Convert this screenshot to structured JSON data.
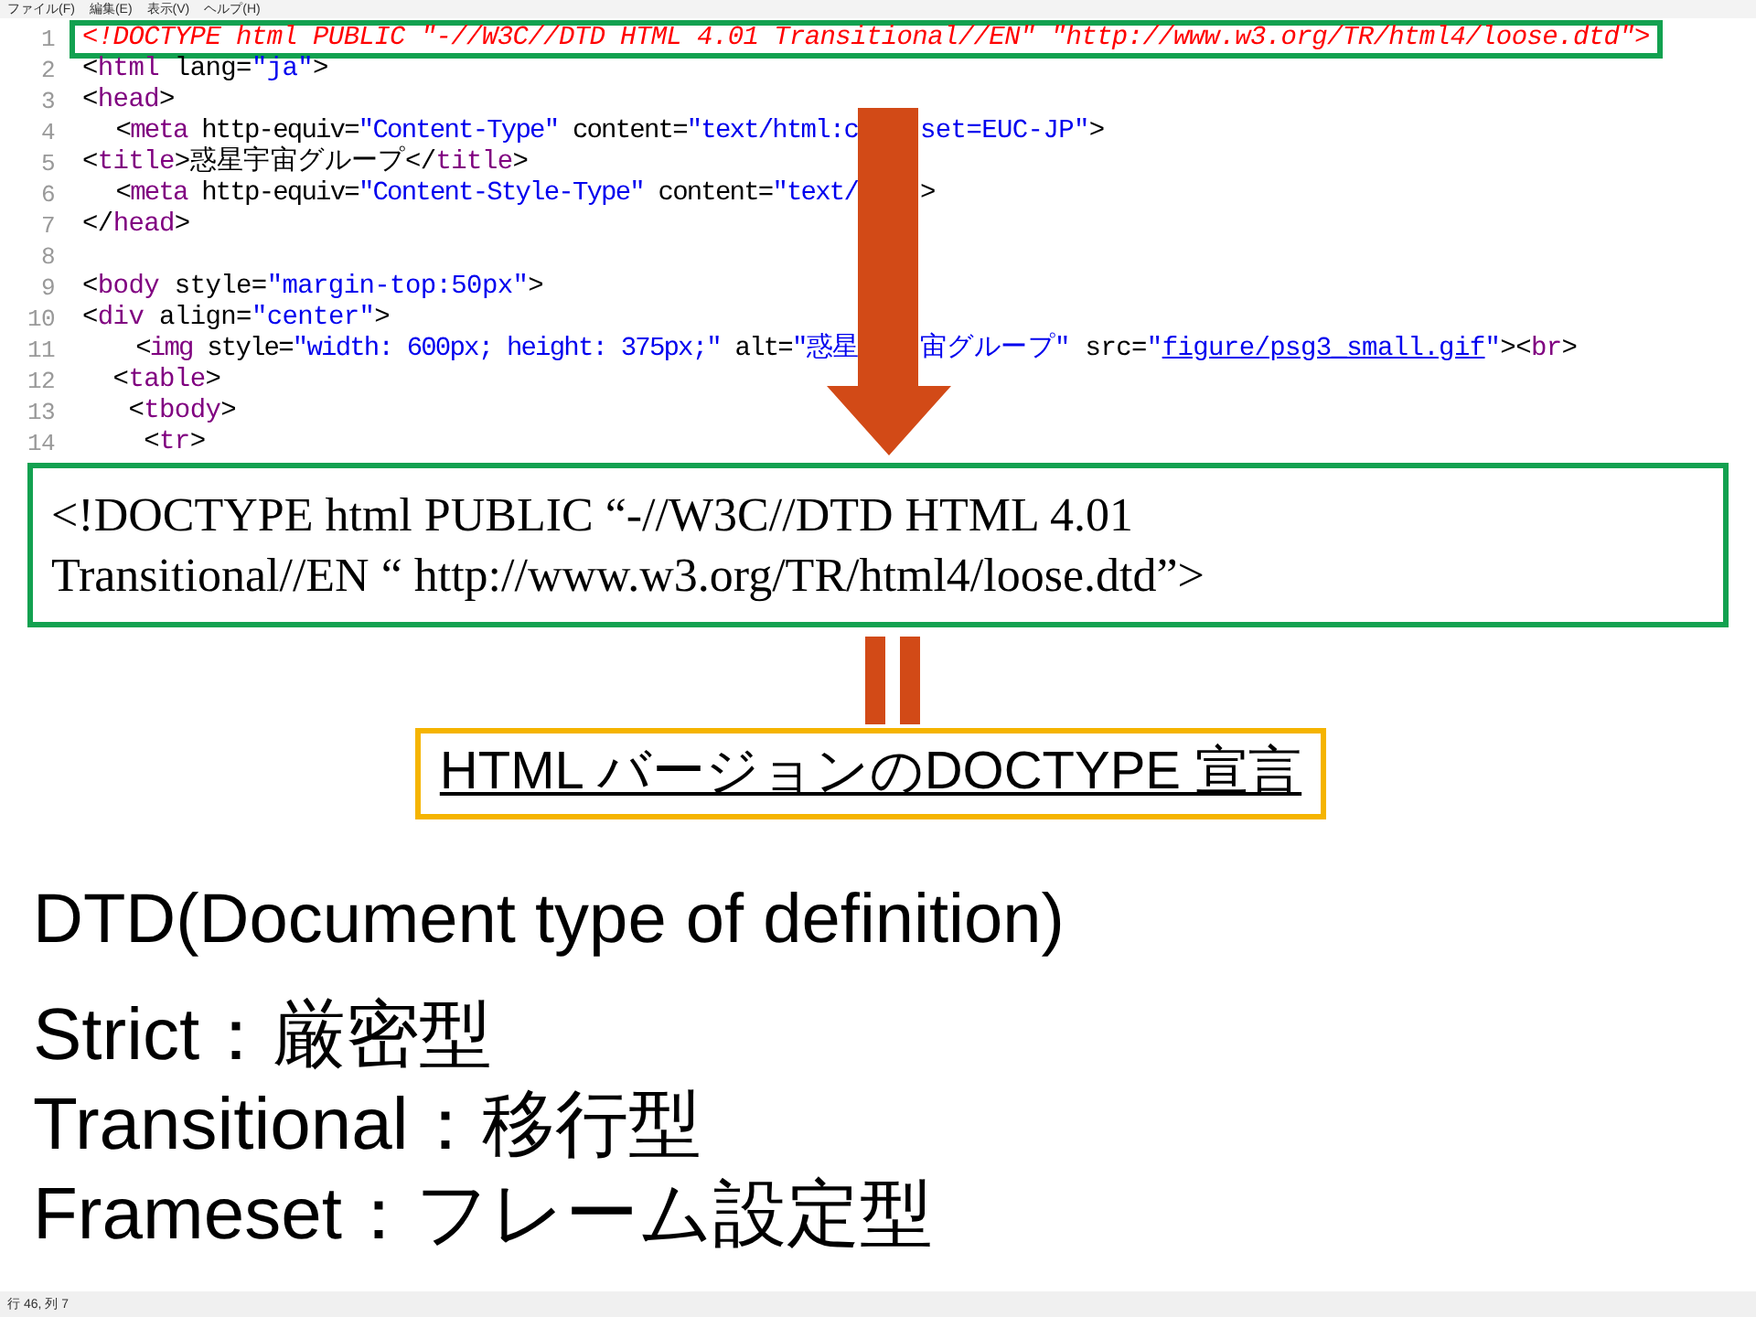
{
  "menu": [
    {
      "label": "ファイル(F)"
    },
    {
      "label": "編集(E)"
    },
    {
      "label": "表示(V)"
    },
    {
      "label": "ヘルプ(H)"
    }
  ],
  "code_lines": [
    {
      "number": "1",
      "highlighted": true,
      "tokens": [
        {
          "kind": "doctype",
          "text": "<!DOCTYPE html PUBLIC \"-//W3C//DTD HTML 4.01 Transitional//EN\" \"http://www.w3.org/TR/html4/loose.dtd\">"
        }
      ]
    },
    {
      "number": "2",
      "highlighted": false,
      "tokens": [
        {
          "kind": "punct",
          "text": "<"
        },
        {
          "kind": "tag",
          "text": "html"
        },
        {
          "kind": "attr",
          "text": " lang="
        },
        {
          "kind": "value",
          "text": "\"ja\""
        },
        {
          "kind": "punct",
          "text": ">"
        }
      ]
    },
    {
      "number": "3",
      "highlighted": false,
      "tokens": [
        {
          "kind": "punct",
          "text": "<"
        },
        {
          "kind": "tag",
          "text": "head"
        },
        {
          "kind": "punct",
          "text": ">"
        }
      ]
    },
    {
      "number": "4",
      "highlighted": false,
      "tokens": [
        {
          "kind": "punct",
          "text": "<"
        },
        {
          "kind": "tag",
          "text": "meta"
        },
        {
          "kind": "attr",
          "text": " http-equiv="
        },
        {
          "kind": "value",
          "text": "\"Content-Type\""
        },
        {
          "kind": "attr",
          "text": " content="
        },
        {
          "kind": "value",
          "text": "\"text/html:c"
        },
        {
          "kind": "gap"
        },
        {
          "kind": "value",
          "text": "set=EUC-JP\""
        },
        {
          "kind": "punct",
          "text": ">"
        }
      ]
    },
    {
      "number": "5",
      "highlighted": false,
      "tokens": [
        {
          "kind": "punct",
          "text": "<"
        },
        {
          "kind": "tag",
          "text": "title"
        },
        {
          "kind": "punct",
          "text": ">"
        },
        {
          "kind": "punct",
          "text": "惑星宇宙グループ"
        },
        {
          "kind": "punct",
          "text": "</"
        },
        {
          "kind": "tag",
          "text": "title"
        },
        {
          "kind": "punct",
          "text": ">"
        }
      ]
    },
    {
      "number": "6",
      "highlighted": false,
      "tokens": [
        {
          "kind": "punct",
          "text": "<"
        },
        {
          "kind": "tag",
          "text": "meta"
        },
        {
          "kind": "attr",
          "text": " http-equiv="
        },
        {
          "kind": "value",
          "text": "\"Content-Style-Type\""
        },
        {
          "kind": "attr",
          "text": " content="
        },
        {
          "kind": "value",
          "text": "\"text/"
        },
        {
          "kind": "gap"
        },
        {
          "kind": "punct",
          "text": ">"
        }
      ]
    },
    {
      "number": "7",
      "highlighted": false,
      "tokens": [
        {
          "kind": "punct",
          "text": "</"
        },
        {
          "kind": "tag",
          "text": "head"
        },
        {
          "kind": "punct",
          "text": ">"
        }
      ]
    },
    {
      "number": "8",
      "highlighted": false
    },
    {
      "number": "9",
      "highlighted": false,
      "tokens": [
        {
          "kind": "punct",
          "text": "<"
        },
        {
          "kind": "tag",
          "text": "body"
        },
        {
          "kind": "attr",
          "text": " style="
        },
        {
          "kind": "value",
          "text": "\"margin-top:50px\""
        },
        {
          "kind": "punct",
          "text": ">"
        }
      ]
    },
    {
      "number": "10",
      "highlighted": false,
      "tokens": [
        {
          "kind": "punct",
          "text": "<"
        },
        {
          "kind": "tag",
          "text": "div"
        },
        {
          "kind": "attr",
          "text": " align="
        },
        {
          "kind": "value",
          "text": "\"center\""
        },
        {
          "kind": "punct",
          "text": ">"
        }
      ]
    },
    {
      "number": "11",
      "highlighted": false,
      "tokens": [
        {
          "kind": "punct",
          "text": "  <"
        },
        {
          "kind": "tag",
          "text": "img"
        },
        {
          "kind": "attr",
          "text": " style="
        },
        {
          "kind": "value",
          "text": "\"width: 600px; height: 375px;\""
        },
        {
          "kind": "attr",
          "text": " alt="
        },
        {
          "kind": "value",
          "text": "\"惑星"
        },
        {
          "kind": "gap"
        },
        {
          "kind": "value",
          "text": "宙グループ\""
        },
        {
          "kind": "attr",
          "text": " src="
        },
        {
          "kind": "value",
          "text": "\""
        },
        {
          "kind": "link",
          "text": "figure/psg3_small.gif"
        },
        {
          "kind": "value",
          "text": "\""
        },
        {
          "kind": "punct",
          "text": "><"
        },
        {
          "kind": "tag",
          "text": "br"
        },
        {
          "kind": "punct",
          "text": ">"
        }
      ]
    },
    {
      "number": "12",
      "highlighted": false,
      "tokens": [
        {
          "kind": "punct",
          "text": "  <"
        },
        {
          "kind": "tag",
          "text": "table"
        },
        {
          "kind": "punct",
          "text": ">"
        }
      ]
    },
    {
      "number": "13",
      "highlighted": false,
      "tokens": [
        {
          "kind": "punct",
          "text": "   <"
        },
        {
          "kind": "tag",
          "text": "tbody"
        },
        {
          "kind": "punct",
          "text": ">"
        }
      ]
    },
    {
      "number": "14",
      "highlighted": false,
      "tokens": [
        {
          "kind": "punct",
          "text": "    <"
        },
        {
          "kind": "tag",
          "text": "tr"
        },
        {
          "kind": "punct",
          "text": ">"
        }
      ]
    }
  ],
  "callout": {
    "lines": [
      "<!DOCTYPE html PUBLIC “-//W3C//DTD HTML 4.01",
      "Transitional//EN “ http://www.w3.org/TR/html4/loose.dtd”>"
    ]
  },
  "label": "HTML バージョンのDOCTYPE 宣言",
  "heading": "DTD(Document type of definition)",
  "definitions": [
    "Strict：厳密型",
    "Transitional：移行型",
    "Frameset：フレーム設定型"
  ],
  "status_bar": "行 46, 列 7"
}
